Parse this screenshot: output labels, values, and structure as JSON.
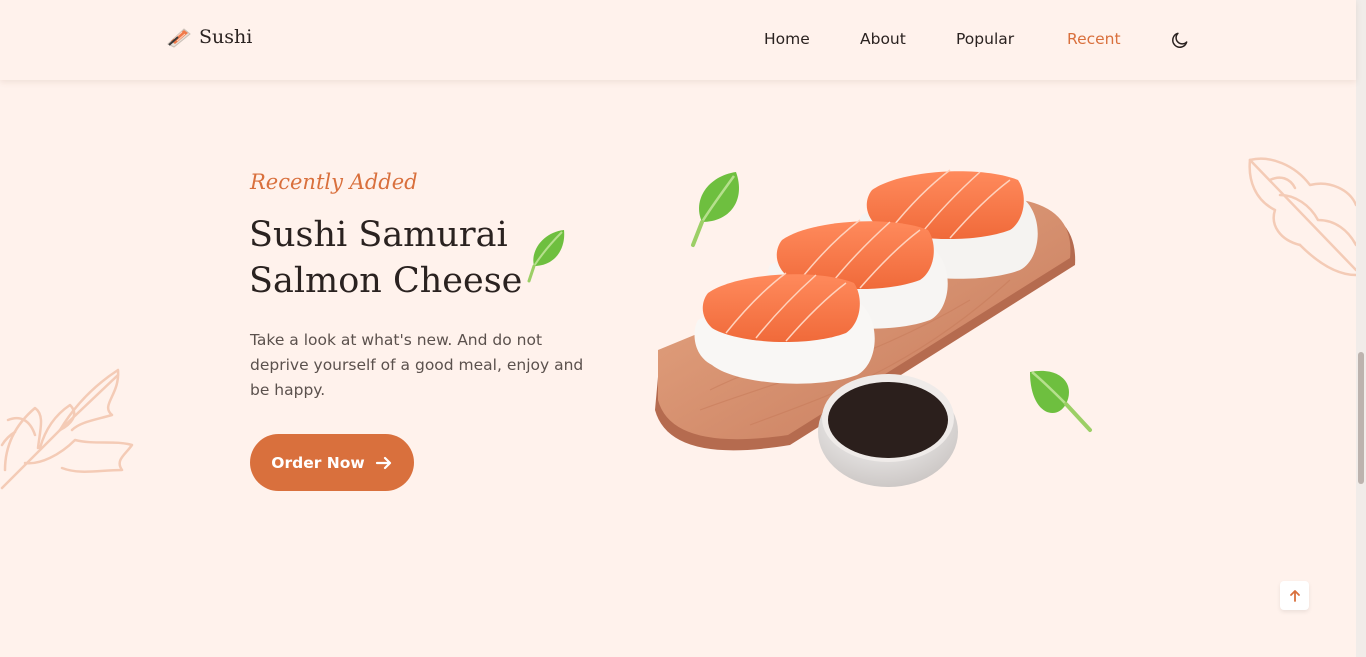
{
  "header": {
    "logo_text": "Sushi",
    "nav": [
      {
        "label": "Home",
        "active": false
      },
      {
        "label": "About",
        "active": false
      },
      {
        "label": "Popular",
        "active": false
      },
      {
        "label": "Recent",
        "active": true
      }
    ],
    "theme_icon": "moon-icon"
  },
  "hero": {
    "subtitle": "Recently Added",
    "title_line1": "Sushi Samurai",
    "title_line2": "Salmon Cheese",
    "description": "Take a look at what's new. And do not deprive yourself of a good meal, enjoy and be happy.",
    "button_label": "Order Now",
    "button_icon": "arrow-right-icon"
  },
  "scroll_up_icon": "arrow-up-icon",
  "colors": {
    "accent": "#d9703d",
    "background": "#fff2ec",
    "text": "#2a2220"
  }
}
